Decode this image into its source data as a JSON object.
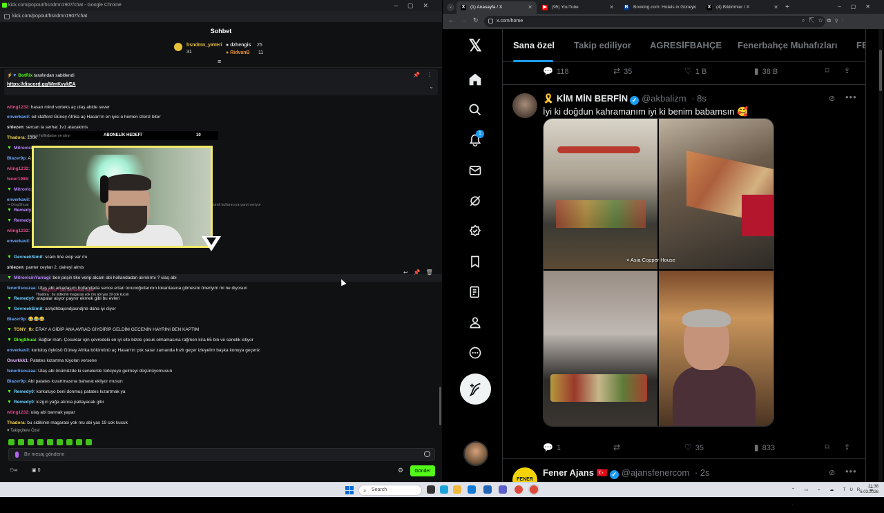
{
  "kick": {
    "window_title": "kick.com/popout/hsndmn1907/chat - Google Chrome",
    "url": "kick.com/popout/hsndmn1907/chat",
    "chat_title": "Sohbet",
    "gifters": [
      {
        "name": "hsndmn_yaVeri",
        "count": "31",
        "color": "#e8c33a"
      },
      {
        "name": "dzhengis",
        "count": "25",
        "color": "#cfcfcf"
      },
      {
        "name": "RidvanB",
        "count": "11",
        "color": "#e8933a"
      }
    ],
    "pinned": {
      "by_user": "BotRix",
      "by_suffix": "tarafından sabitlendi",
      "link": "https://discord.gg/MmKyykEA"
    },
    "messages": [
      {
        "user": "wling1232",
        "color": "#e04d8a",
        "text": "hasan mind vorteks aç ulaş abide sever",
        "badge": ""
      },
      {
        "user": "enverkavil",
        "color": "#6aa8ff",
        "text": "ed stafford Güney Afrika aç Hasan'ın en iyisi o hemen izleriz biter",
        "badge": ""
      },
      {
        "user": "shiezen",
        "color": "#e6e6e6",
        "text": "sercan la serhat 1v1 atacakmis",
        "badge": ""
      },
      {
        "user": "Thadora",
        "color": "#f4d447",
        "text": "100k",
        "badge": ""
      },
      {
        "user": "MitrovicinYarragi",
        "color": "#b98aff",
        "text": "ulaş abi hollandadan ev alınır mı ?",
        "badge": "▼"
      },
      {
        "user": "Blazer9p",
        "color": "#6aa8ff",
        "text": "A",
        "badge": ""
      },
      {
        "user": "wling1232",
        "color": "#e04d8a",
        "text": "",
        "badge": ""
      },
      {
        "user": "fener1986",
        "color": "#e04d8a",
        "text": "",
        "badge": ""
      },
      {
        "user": "Mitrovic",
        "color": "#b98aff",
        "text": "",
        "badge": "▼"
      },
      {
        "user": "enverkavil",
        "color": "#6aa8ff",
        "text": "",
        "badge": ""
      },
      {
        "user": "Remedy",
        "color": "#b98aff",
        "text": "",
        "badge": "▼"
      },
      {
        "user": "Remedy",
        "color": "#b98aff",
        "text": "",
        "badge": "▼"
      },
      {
        "user": "wling1232",
        "color": "#e04d8a",
        "text": "",
        "badge": ""
      },
      {
        "user": "enverkavil",
        "color": "#6aa8ff",
        "text": "",
        "badge": ""
      },
      {
        "user": "GevreekSimit",
        "color": "#6fd1ff",
        "text": "scam line ekip var mı",
        "badge": "▼"
      },
      {
        "user": "shiezen",
        "color": "#e6e6e6",
        "text": "panter ceylan 2. daireyi almis",
        "badge": ""
      },
      {
        "user": "MitrovicinYarragi",
        "color": "#b98aff",
        "text": "ben peşin tiko verip alcam abi hollandadan alınılırmı ? ulaş abi",
        "badge": "▼"
      },
      {
        "user": "fenerlisouzaa",
        "color": "#6aa8ff",
        "text": "Ulaş abi arkadaşım hollandada sence ertan torunoğullarının lokantasına gitmesini öneriyim mi ne diyosun",
        "badge": ""
      },
      {
        "user": "Remedy0",
        "color": "#6fd1ff",
        "text": "arapalar alıyor paynır ekmek gibi bu evleri",
        "badge": "▼"
      },
      {
        "user": "GevreekSimit",
        "color": "#6fd1ff",
        "text": "ashjdhbajsndjasndjnb daha iyi diyor",
        "badge": "▼"
      },
      {
        "user": "Blazer9p",
        "color": "#6aa8ff",
        "text": "😂😂😂",
        "badge": ""
      },
      {
        "user": "TONY_fb",
        "color": "#f4d447",
        "text": "ERAY A GİDİP ANA AVRAD GİYDİRİP GELDİM GECENİN HAYRINI BEN KAPTIM",
        "badge": "▼"
      },
      {
        "user": "DingShuai",
        "color": "#53fc18",
        "text": "Bağlar mah. Çocuklar için çevredeki en iyi site bizde çocuk olmamasına rağmen kira 65 bin ve senelik istiyor",
        "badge": "▼"
      },
      {
        "user": "enverkavil",
        "color": "#6aa8ff",
        "text": "kurtuluş öyküsü Güney Afrika bölümünü aç Hasan'ın çok sarar zamanda hızlı geçer izleyelim başka konuya geçeriz",
        "badge": ""
      },
      {
        "user": "Onurkkk1",
        "color": "#e6b7ff",
        "text": "Patates kızartma tüyolan versene",
        "badge": ""
      },
      {
        "user": "fenerlisouzaa",
        "color": "#6aa8ff",
        "text": "Ulaş abi önümüzde ki senelerde türkiyeye gelmeyi düşünüyomusun",
        "badge": ""
      },
      {
        "user": "Blazer9p",
        "color": "#6aa8ff",
        "text": "Abi patates kızartmasına baharat ekliyor musun",
        "badge": ""
      },
      {
        "user": "Remedy0",
        "color": "#6fd1ff",
        "text": "korkutuyo beni donmuş patates kızartmak ya",
        "badge": "▼"
      },
      {
        "user": "Remedy0",
        "color": "#6fd1ff",
        "text": "kızgın yağa atınca patlayacak gibi",
        "badge": "▼"
      },
      {
        "user": "wling1232",
        "color": "#e04d8a",
        "text": "ulaş abi barınak yapar",
        "badge": ""
      },
      {
        "user": "Thadora",
        "color": "#f4d447",
        "text": "bu sidikinin magarasi yok mu abi yas 19 cok kucuk",
        "badge": ""
      }
    ],
    "overlay": {
      "sub_goal_label": "ABONELİK HEDEFİ",
      "sub_goal_count": "10",
      "replying_hint": "simli kullanıcıya yanıt veriyor",
      "reply_user": "DingShuai",
      "overlay_line1": "wling1232 : ulaş abi barınak yapar",
      "overlay_line2": "Thadora : bu sidikinin magarasi yok mu abi yas 19 cok kucuk",
      "holland_fragment": "europe hollindadan ne alınır"
    },
    "followers_only": "Takipçilere Özel",
    "input_placeholder": "Bir mesaj gönderin",
    "bottom_count": "0",
    "send_label": "Gönder"
  },
  "chrome": {
    "tabs": [
      {
        "label": "(1) Anasayfa / X",
        "icon": "X",
        "color": "#000000",
        "active": true
      },
      {
        "label": "(95) YouTube",
        "icon": "▶",
        "color": "#ff0000",
        "active": false
      },
      {
        "label": "Booking.com: Hotels in Güney",
        "icon": "B",
        "color": "#003580",
        "active": false
      },
      {
        "label": "(4) Bildirimler / X",
        "icon": "X",
        "color": "#000000",
        "active": false
      }
    ],
    "url": "x.com/home"
  },
  "x": {
    "tabs": [
      "Sana özel",
      "Takip ediliyor",
      "AGRESİFBAHÇE",
      "Fenerbahçe Muhafızları",
      "FE"
    ],
    "notif_count": "1",
    "prev_post_actions": {
      "replies": "118",
      "reposts": "35",
      "likes": "1 B",
      "views": "38 B"
    },
    "post": {
      "name": "KİM MİN BERFİN",
      "handle": "@akbalizm",
      "time": "· 8s",
      "text": "İyi ki doğdun kahramanım iyi ki benim babamsın 🥰",
      "location_tag": "Asia Copper House",
      "replies": "1",
      "reposts": "",
      "likes": "35",
      "views": "833"
    },
    "next_post": {
      "name": "Fener Ajans",
      "flag": "🇹🇷",
      "handle": "@ajansfenercom",
      "time": "· 2s"
    }
  },
  "taskbar": {
    "search_placeholder": "Search",
    "lang": "TUR",
    "time": "21:38",
    "date": "6.03.2026"
  }
}
